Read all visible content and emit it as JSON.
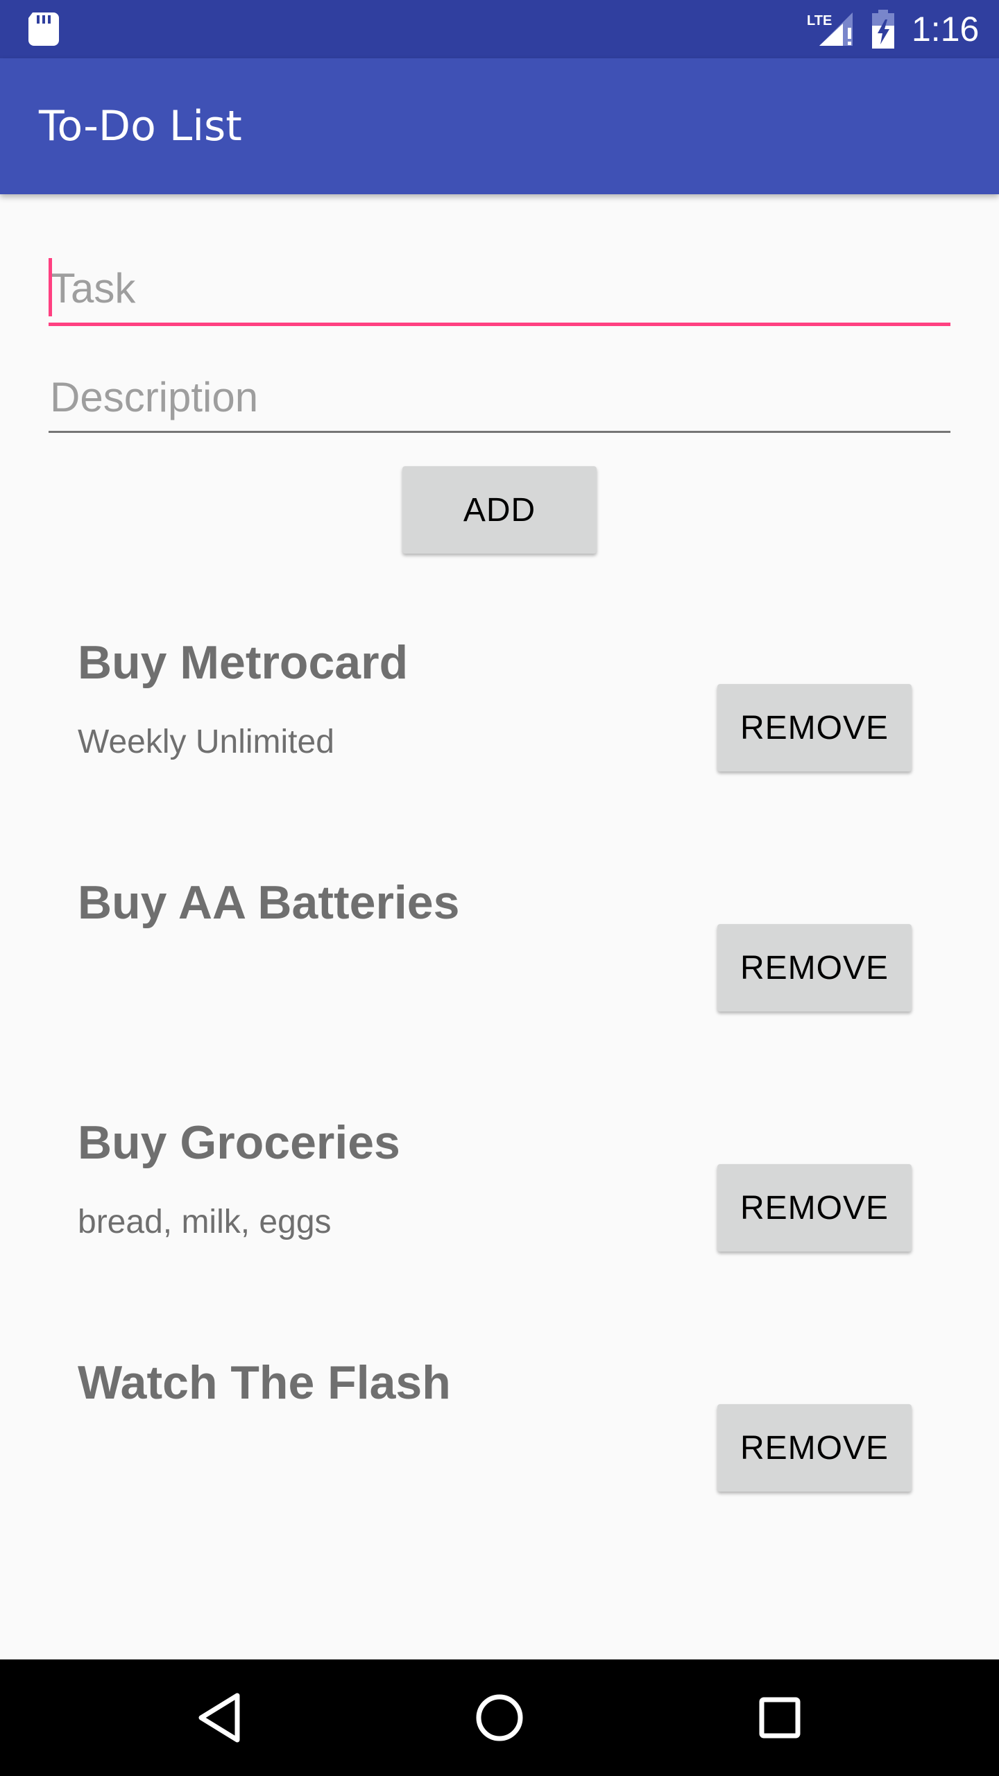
{
  "status_bar": {
    "time": "1:16",
    "network_label": "LTE",
    "icons": [
      "sd-card-icon",
      "lte-signal-icon",
      "battery-charging-icon"
    ]
  },
  "app_bar": {
    "title": "To-Do List"
  },
  "form": {
    "task_placeholder": "Task",
    "task_value": "",
    "description_placeholder": "Description",
    "description_value": "",
    "add_label": "ADD"
  },
  "tasks": [
    {
      "title": "Buy Metrocard",
      "description": "Weekly Unlimited",
      "remove_label": "REMOVE"
    },
    {
      "title": "Buy AA Batteries",
      "description": "",
      "remove_label": "REMOVE"
    },
    {
      "title": "Buy Groceries",
      "description": "bread, milk, eggs",
      "remove_label": "REMOVE"
    },
    {
      "title": "Watch The Flash",
      "description": "",
      "remove_label": "REMOVE"
    }
  ],
  "nav_bar": {
    "icons": [
      "back-icon",
      "home-icon",
      "recents-icon"
    ]
  },
  "colors": {
    "status_bar": "#303F9F",
    "primary": "#3F51B5",
    "accent": "#FF4081",
    "background": "#FAFAFA",
    "button": "#D6D7D7",
    "task_text": "#6F6F6F",
    "nav_bar": "#000000"
  }
}
